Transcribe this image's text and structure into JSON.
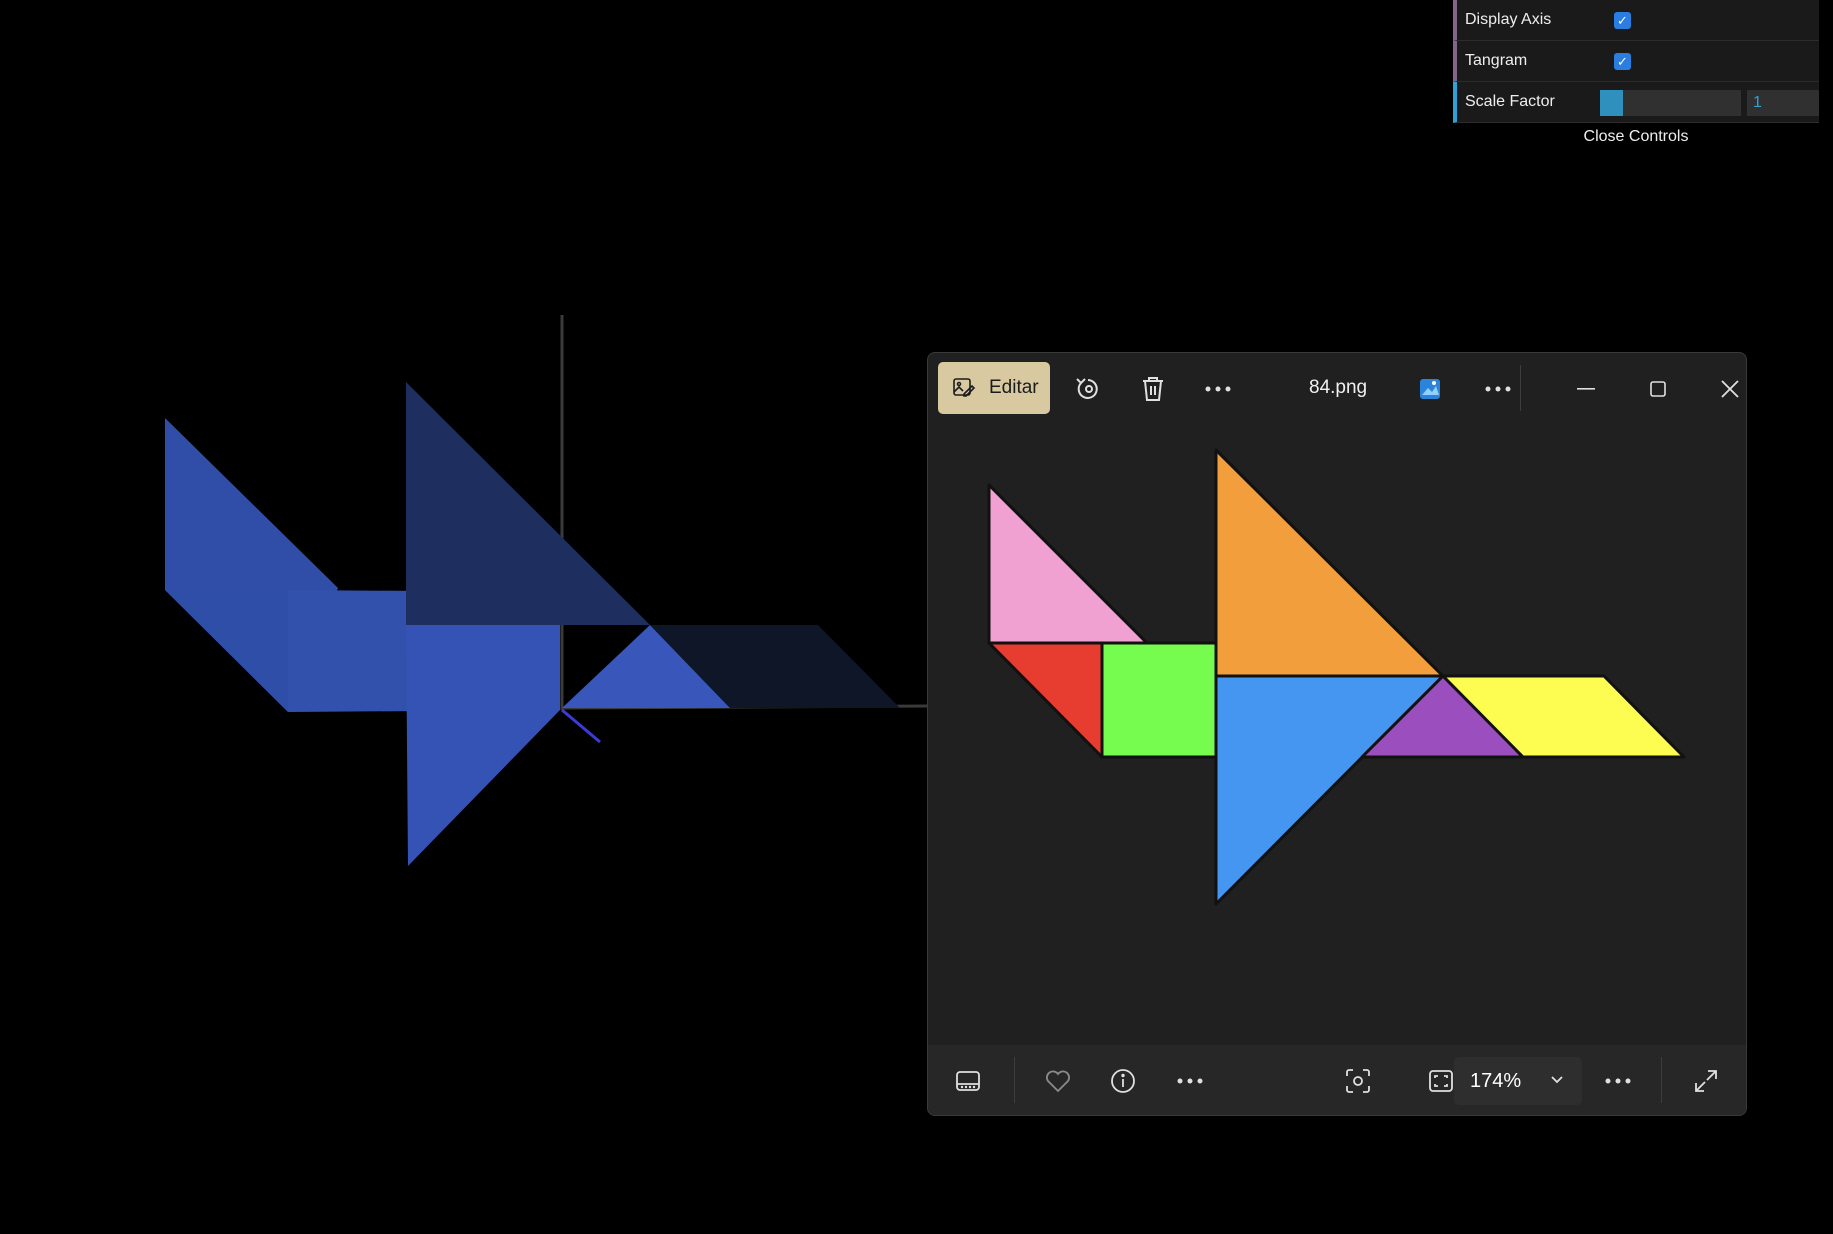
{
  "controls": {
    "display_axis_label": "Display Axis",
    "display_axis_checked": true,
    "tangram_label": "Tangram",
    "tangram_checked": true,
    "scale_factor_label": "Scale Factor",
    "scale_factor_value": "1",
    "scale_factor_fill": 0.16,
    "close_label": "Close Controls"
  },
  "scene": {
    "shape_color": "#3a5bc7",
    "background": "#000000"
  },
  "photo_viewer": {
    "edit_label": "Editar",
    "filename": "84.png",
    "zoom_value": "174%",
    "titlebar_icons": [
      "edit-image-icon",
      "rotate-icon",
      "delete-icon",
      "more-icon",
      "photos-app-icon",
      "more-icon",
      "minimize-icon",
      "maximize-icon",
      "close-icon"
    ],
    "bottom_icons": [
      "filmstrip-icon",
      "favorite-heart-icon",
      "info-icon",
      "more-icon",
      "visual-search-icon",
      "fit-screen-icon",
      "chevron-down-icon",
      "more-icon",
      "fullscreen-icon"
    ],
    "tangram_pieces": [
      {
        "name": "pink-triangle",
        "color": "#f0a1d1"
      },
      {
        "name": "red-triangle",
        "color": "#e73c30"
      },
      {
        "name": "green-square",
        "color": "#76fc4f"
      },
      {
        "name": "orange-triangle",
        "color": "#f29e3c"
      },
      {
        "name": "blue-triangle",
        "color": "#4596f1"
      },
      {
        "name": "purple-triangle",
        "color": "#9b4fbe"
      },
      {
        "name": "yellow-parallelogram",
        "color": "#fdfd51"
      }
    ]
  }
}
